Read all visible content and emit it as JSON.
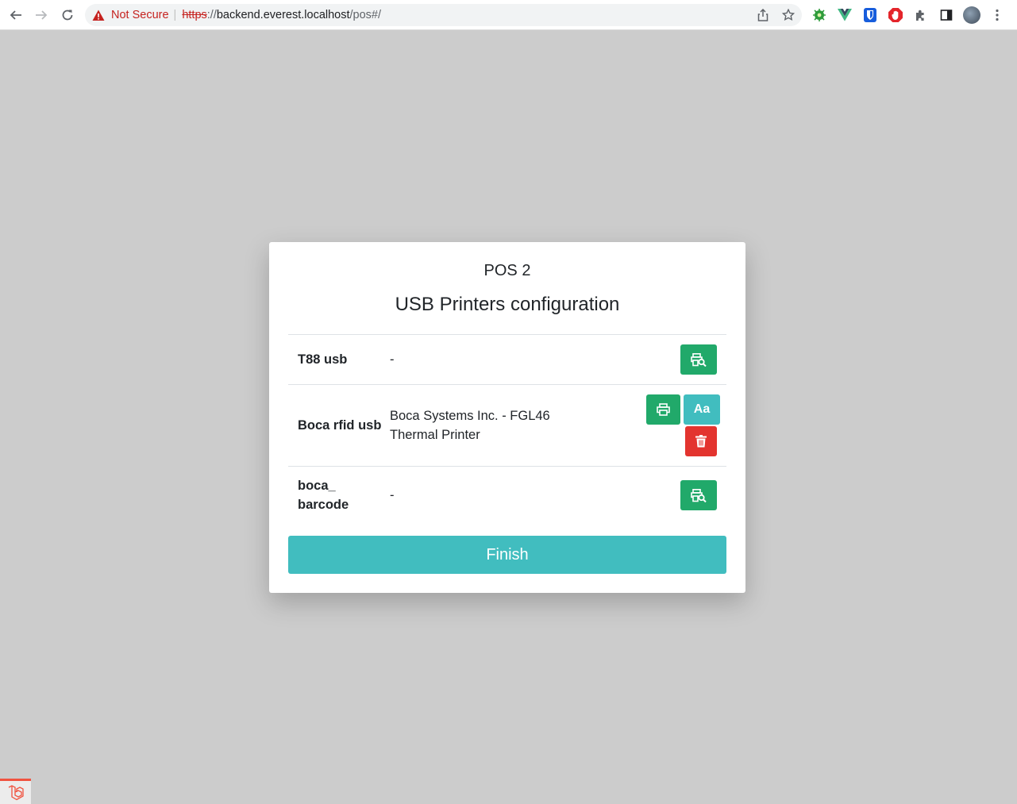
{
  "browser": {
    "security_label": "Not Secure",
    "url_scheme": "https",
    "url_separator": "://",
    "url_host": "backend.everest.localhost",
    "url_path": "/pos#/"
  },
  "modal": {
    "pos_name": "POS 2",
    "title": "USB Printers configuration",
    "printers": [
      {
        "name": "T88 usb",
        "device": "-",
        "state": "unassigned"
      },
      {
        "name": "Boca rfid usb",
        "device_line1": "Boca Systems Inc. - FGL46",
        "device_line2": "Thermal Printer",
        "state": "assigned"
      },
      {
        "name_line1": "boca_",
        "name_line2": "barcode",
        "device": "-",
        "state": "unassigned"
      }
    ],
    "font_button_label": "Aa",
    "finish_label": "Finish"
  },
  "colors": {
    "success": "#21a96a",
    "info": "#41bdbf",
    "danger": "#e3342f",
    "backdrop": "#cccccc"
  },
  "icons": {
    "search_printer": "printer-search-icon",
    "print": "printer-icon",
    "delete": "trash-icon",
    "font": "font-icon"
  }
}
